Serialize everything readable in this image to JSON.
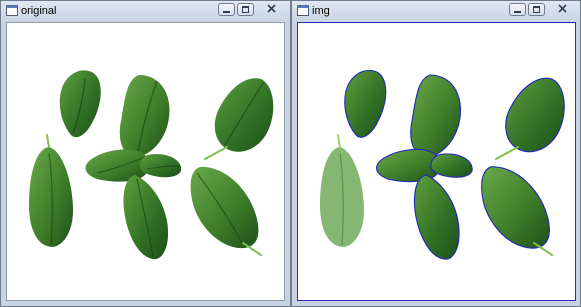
{
  "windows": [
    {
      "title": "original"
    },
    {
      "title": "img"
    }
  ],
  "colors": {
    "leaf_dark": "#1f4f1a",
    "leaf_mid": "#2f6f24",
    "leaf_light": "#5f9f3e",
    "contour": "#2427b8"
  }
}
